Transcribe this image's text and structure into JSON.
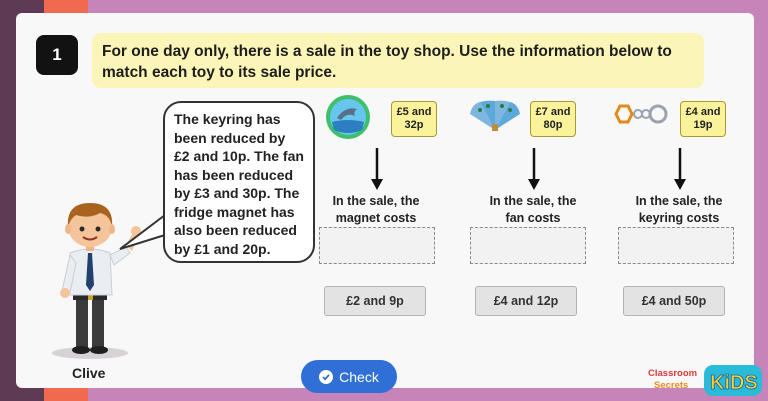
{
  "question": {
    "number": "1",
    "instruction": "For one day only, there is a sale in the toy shop. Use the information below to match each toy to its sale price."
  },
  "speech": "The keyring has been reduced by £2 and 10p. The fan has been reduced by £3 and 30p. The fridge magnet has also been reduced by £1 and 20p.",
  "character": {
    "name": "Clive"
  },
  "items": [
    {
      "icon": "dolphin-magnet-icon",
      "tag_line1": "£5 and",
      "tag_line2": "32p",
      "caption_line1": "In the sale, the",
      "caption_line2": "magnet costs"
    },
    {
      "icon": "peacock-fan-icon",
      "tag_line1": "£7 and",
      "tag_line2": "80p",
      "caption_line1": "In the sale, the",
      "caption_line2": "fan costs"
    },
    {
      "icon": "keyring-icon",
      "tag_line1": "£4 and",
      "tag_line2": "19p",
      "caption_line1": "In the sale, the",
      "caption_line2": "keyring costs"
    }
  ],
  "options": [
    "£2 and 9p",
    "£4 and 12p",
    "£4 and 50p"
  ],
  "check_label": "Check",
  "logo": {
    "line1": "Classroom",
    "line2": "Secrets",
    "kids": "KiDS"
  },
  "colors": {
    "accent": "#2f6fd6",
    "instruction_bg": "#fbf5b8",
    "tag_bg": "#faf39b",
    "stripe_dark": "#5e3a55",
    "stripe_coral": "#ef6a4f",
    "stripe_pink": "#c784b8"
  }
}
